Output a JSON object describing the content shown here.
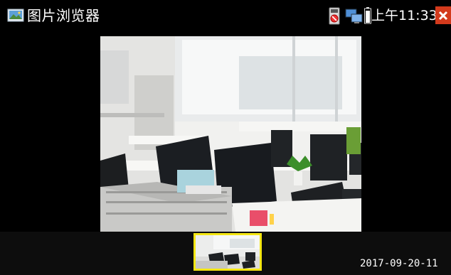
{
  "window": {
    "title": "图片浏览器",
    "icon": "picture-viewer-icon"
  },
  "status_bar": {
    "time": "上午11:33",
    "icons": [
      "storage-card-icon",
      "network-icon",
      "battery-icon",
      "close-icon"
    ]
  },
  "viewer": {
    "image": "office-photo"
  },
  "filmstrip": {
    "selected_thumbnail": "office-photo-thumbnail",
    "date": "2017-09-20-11"
  },
  "colors": {
    "background": "#000000",
    "close_button": "#d33a1c",
    "thumbnail_border": "#f4e612"
  }
}
